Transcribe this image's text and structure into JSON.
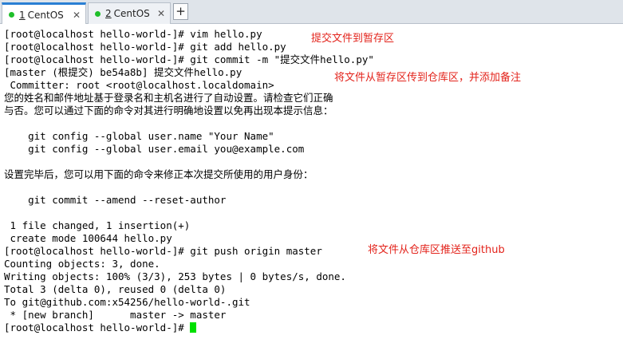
{
  "tabs": [
    {
      "number": "1",
      "name": "CentOS",
      "close": "✕",
      "active": true
    },
    {
      "number": "2",
      "name": "CentOS",
      "close": "✕",
      "active": false
    }
  ],
  "add_tab_label": "+",
  "colors": {
    "tab_status_dot": "#1fbf2a",
    "active_tab_accent": "#2a7fd4",
    "annotation": "#e3231b",
    "cursor": "#00e000"
  },
  "terminal": {
    "lines": [
      "[root@localhost hello-world-]# vim hello.py",
      "[root@localhost hello-world-]# git add hello.py",
      "[root@localhost hello-world-]# git commit -m \"提交文件hello.py\"",
      "[master (根提交) be54a8b] 提交文件hello.py",
      " Committer: root <root@localhost.localdomain>",
      "您的姓名和邮件地址基于登录名和主机名进行了自动设置。请检查它们正确",
      "与否。您可以通过下面的命令对其进行明确地设置以免再出现本提示信息：",
      "",
      "    git config --global user.name \"Your Name\"",
      "    git config --global user.email you@example.com",
      "",
      "设置完毕后，您可以用下面的命令来修正本次提交所使用的用户身份：",
      "",
      "    git commit --amend --reset-author",
      "",
      " 1 file changed, 1 insertion(+)",
      " create mode 100644 hello.py",
      "[root@localhost hello-world-]# git push origin master",
      "Counting objects: 3, done.",
      "Writing objects: 100% (3/3), 253 bytes | 0 bytes/s, done.",
      "Total 3 (delta 0), reused 0 (delta 0)",
      "To git@github.com:x54256/hello-world-.git",
      " * [new branch]      master -> master",
      "[root@localhost hello-world-]# "
    ]
  },
  "annotations": {
    "add_note": "提交文件到暂存区",
    "commit_note": "将文件从暂存区传到仓库区，并添加备注",
    "push_note": "将文件从仓库区推送至github"
  }
}
